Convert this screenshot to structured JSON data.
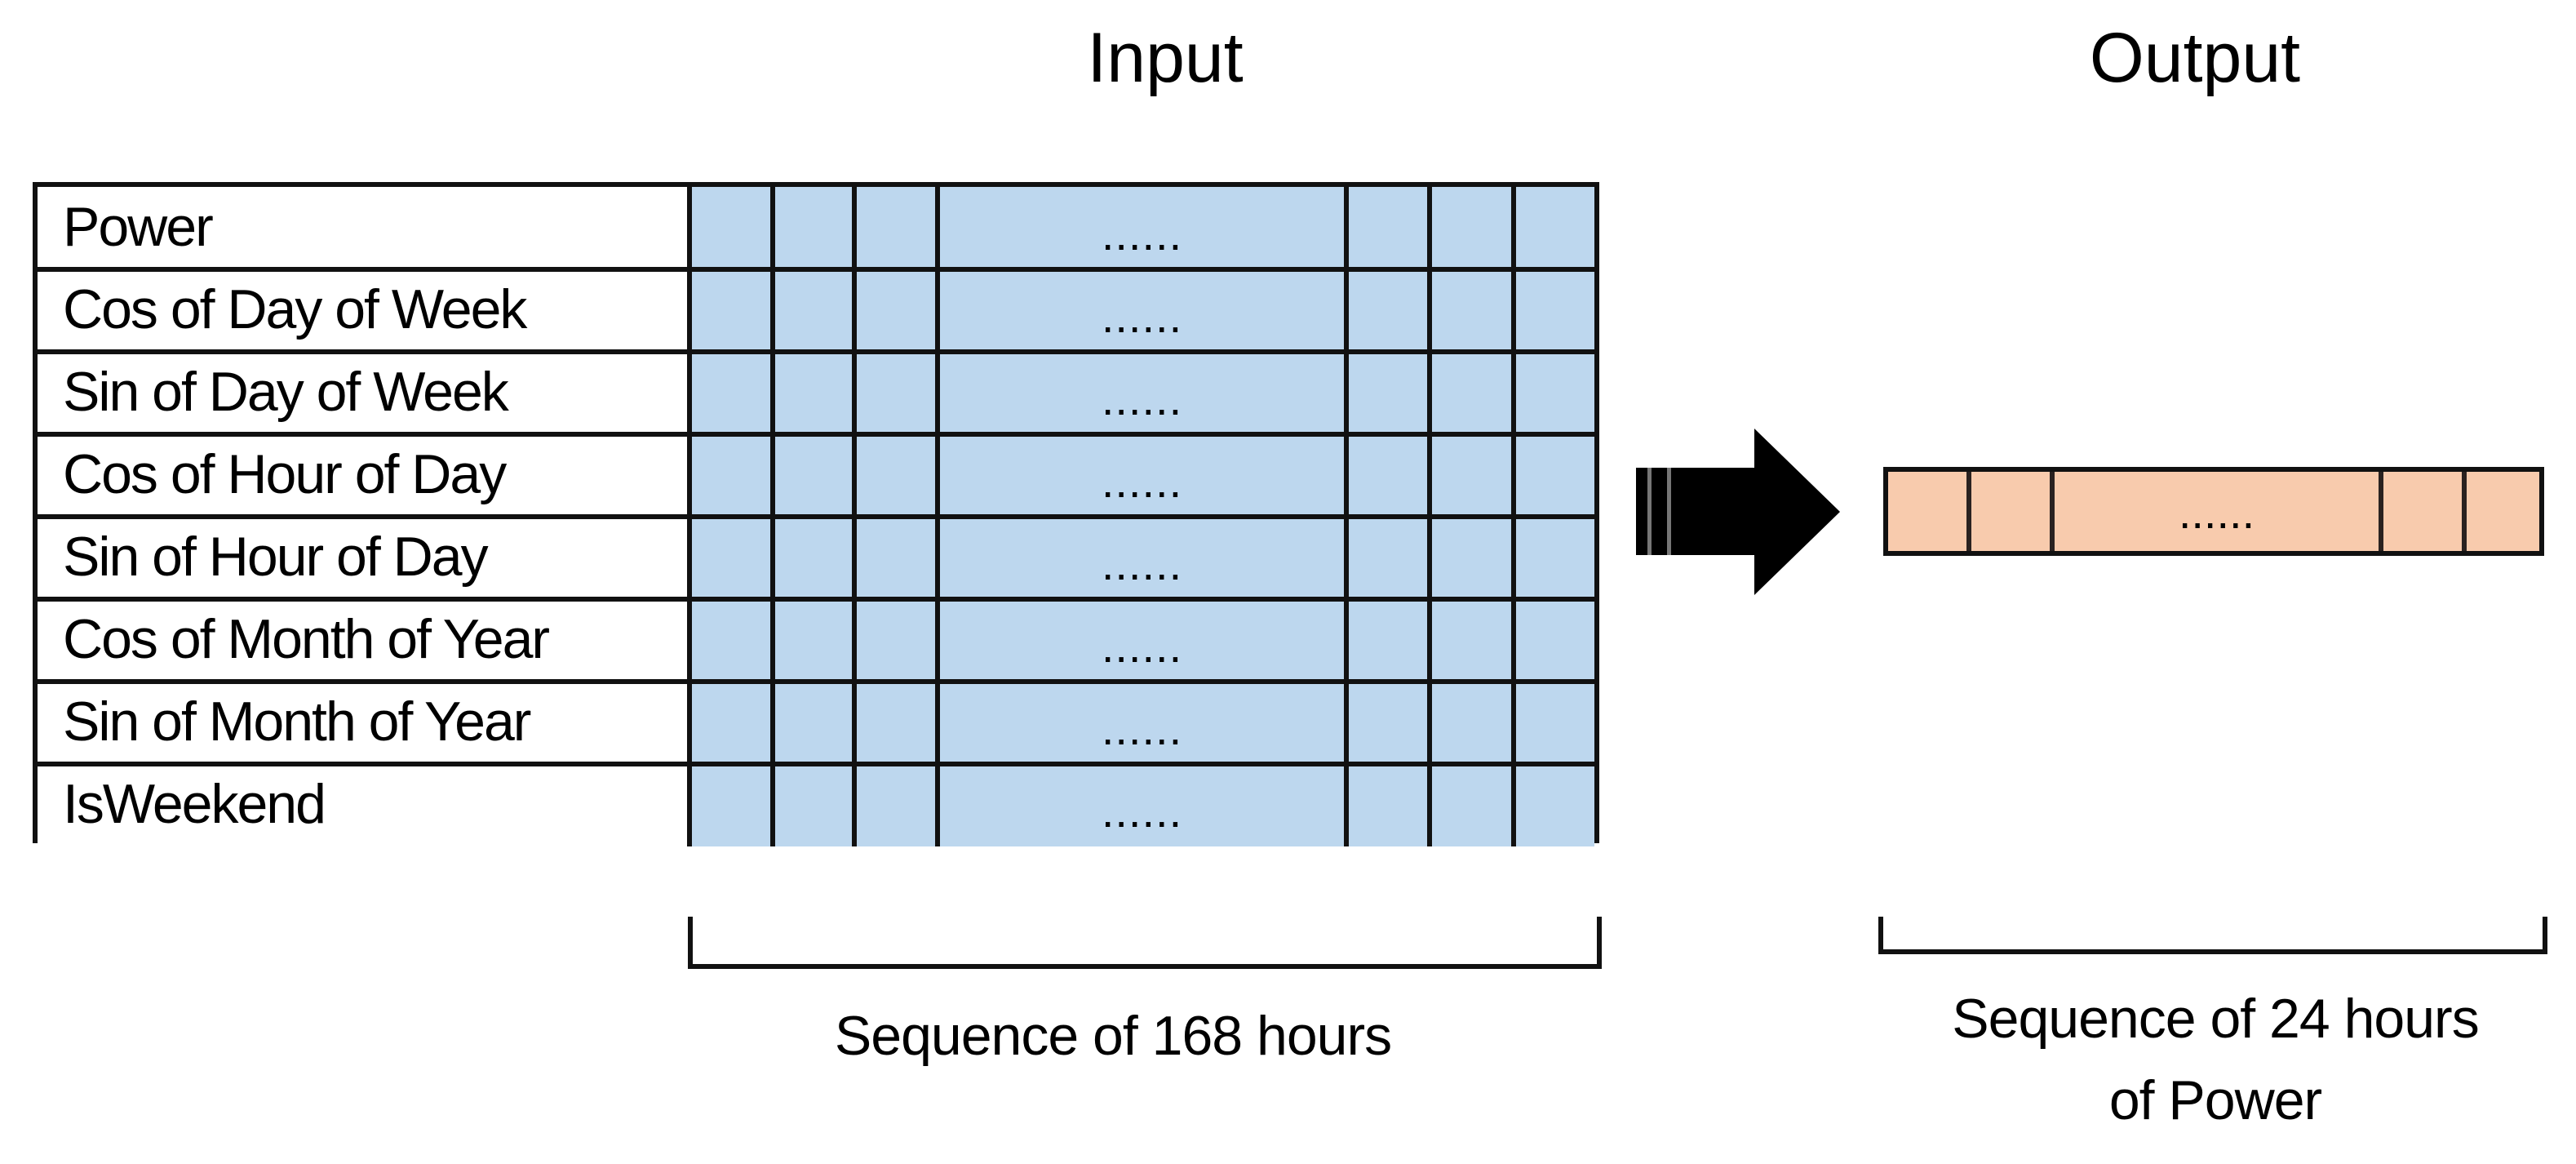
{
  "titles": {
    "input": "Input",
    "output": "Output"
  },
  "features": [
    "Power",
    "Cos of Day of Week",
    "Sin of Day of Week",
    "Cos of Hour of Day",
    "Sin of Hour of Day",
    "Cos of Month of Year",
    "Sin of Month of Year",
    "IsWeekend"
  ],
  "grid": {
    "ellipsis": "......",
    "leading_cells": 3,
    "trailing_cells": 3
  },
  "output_bar": {
    "ellipsis": "......",
    "leading_cells": 2,
    "trailing_cells": 2
  },
  "captions": {
    "input": "Sequence of 168 hours",
    "output_line1": "Sequence of 24 hours",
    "output_line2": "of Power"
  },
  "icons": {
    "transform_arrow": "right-arrow-icon"
  },
  "colors": {
    "input_cell": "#BDD7EE",
    "output_cell": "#F8CBAD",
    "border": "#111111"
  }
}
